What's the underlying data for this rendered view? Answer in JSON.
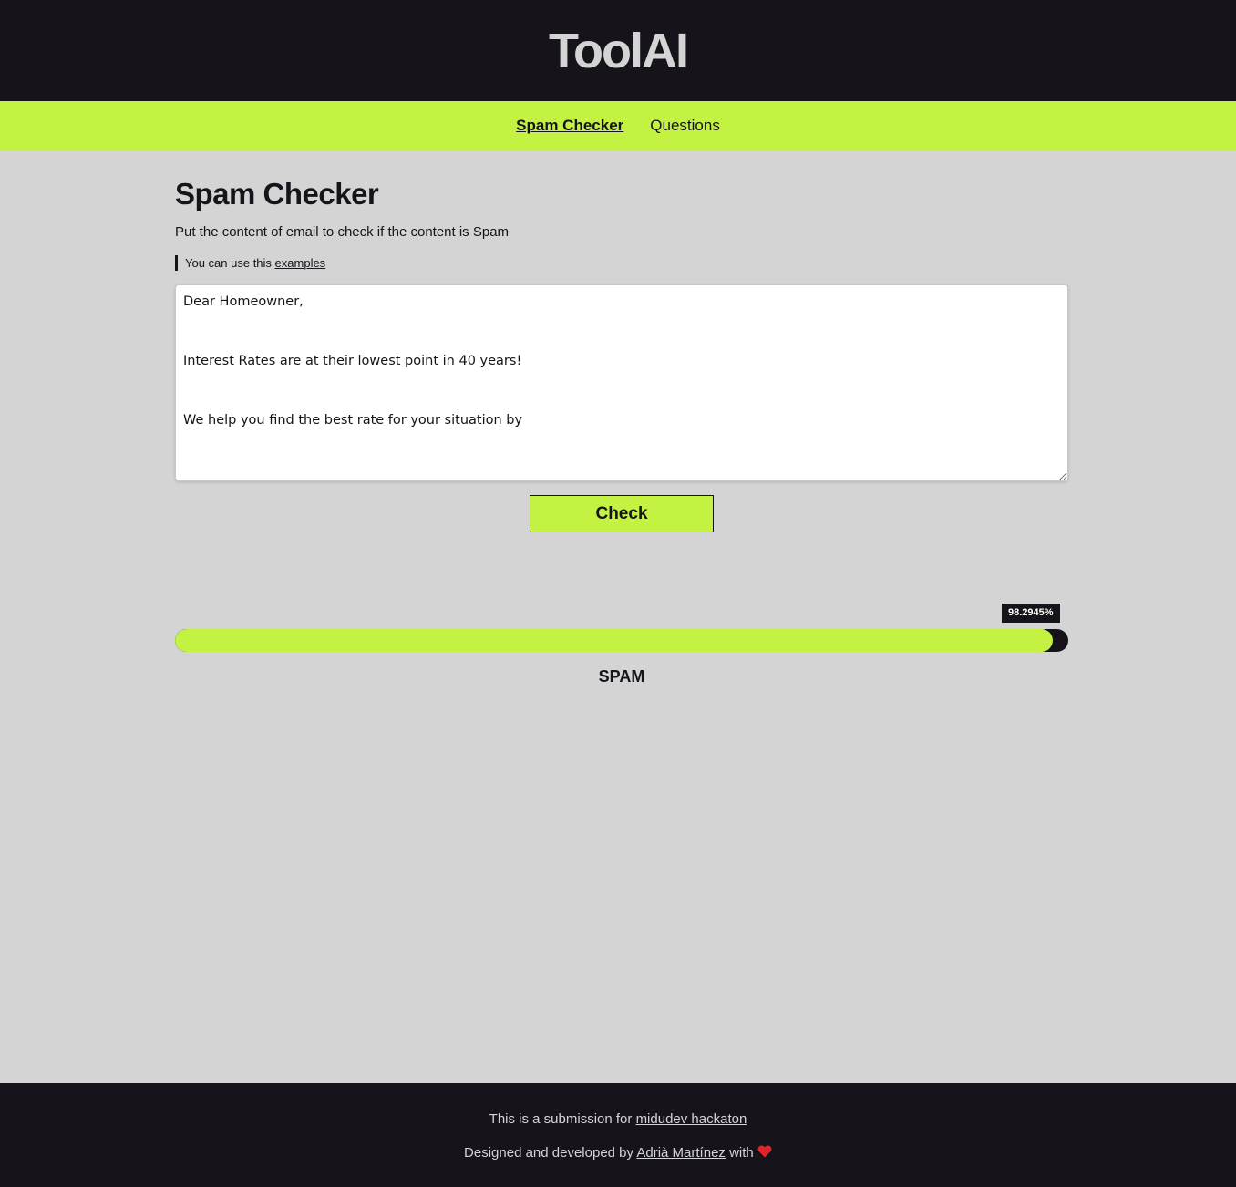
{
  "header": {
    "logo": "ToolAI"
  },
  "nav": {
    "items": [
      {
        "label": "Spam Checker",
        "active": true
      },
      {
        "label": "Questions",
        "active": false
      }
    ]
  },
  "main": {
    "title": "Spam Checker",
    "description": "Put the content of email to check if the content is Spam",
    "hint": {
      "prefix": "You can use this ",
      "link": "examples"
    },
    "content": "Dear Homeowner,\n\n\nInterest Rates are at their lowest point in 40 years!\n\n\nWe help you find the best rate for your situation by",
    "check_label": "Check",
    "result": {
      "percent_label": "98.2945%",
      "percent_value": 98.2945,
      "label": "SPAM"
    }
  },
  "footer": {
    "line1_prefix": "This is a submission for ",
    "line1_link": "midudev hackaton",
    "line2_prefix": "Designed and developed by ",
    "line2_link": "Adrià Martínez",
    "line2_suffix": " with "
  },
  "colors": {
    "accent": "#c4f243",
    "dark": "#16141a",
    "background": "#d4d4d4"
  },
  "icons": {
    "heart": "heart-icon"
  }
}
